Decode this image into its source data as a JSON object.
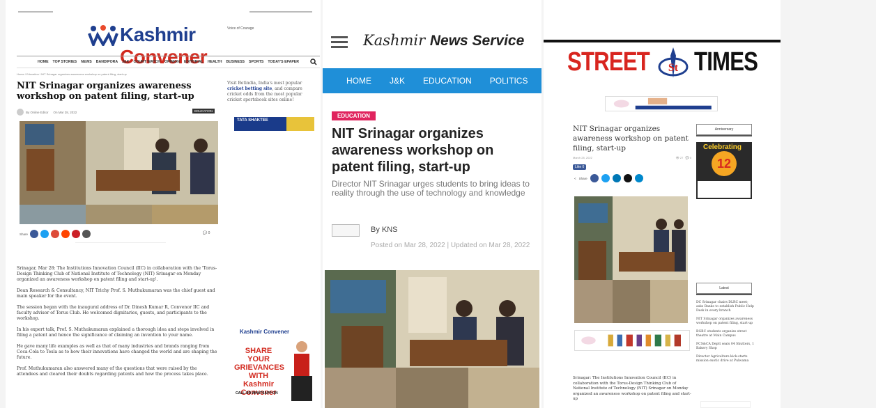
{
  "panel1": {
    "logo_k": "Kashmir",
    "logo_c": "Convener",
    "tagline": "Voice of Courage",
    "nav": [
      "HOME",
      "TOP STORIES",
      "NEWS",
      "BANDIPORA",
      "J&K",
      "COURT WATCH",
      "OPINION",
      "EDITORIAL",
      "HEALTH",
      "BUSINESS",
      "SPORTS",
      "TODAY'S EPAPER"
    ],
    "breadcrumb": "Home  /  Education  /  NIT Srinagar organizes awareness workshop on patent filing, start-up",
    "title": "NIT Srinagar organizes awareness workshop on patent filing, start-up",
    "author": "By  Online Editor",
    "date": "On  Mar 28, 2022",
    "category": "EDUCATION",
    "share_label": "Share",
    "comments": "0",
    "side_text_pre": "Visit Betindia, India's most popular ",
    "side_text_link": "cricket betting site",
    "side_text_post": ", and compare cricket odds from the most popular cricket sportsbook sites online!",
    "tata_label": "TATA SHAKTEE",
    "paragraphs": [
      "Srinagar, Mar 28: The Institutions Innovation Council (IIC) in collaboration with the 'Torus-Design Thinking Club of National Institute of Technology (NIT) Srinagar on Monday organized an awareness workshop on patent filing and start-up'.",
      "Dean Research & Consultancy, NIT Trichy Prof. S. Muthukumaran was the chief guest and main speaker for the event.",
      "The session began with the inaugural address of Dr. Dinesh Kumar R, Convenor IIC and faculty advisor of Torus Club. He welcomed dignitaries, guests, and participants to the workshop.",
      "In his expert talk, Prof. S. Muthukumaran explained a thorough idea and steps involved in filing a patent and hence the significance of claiming an invention to your name.",
      "He gave many life examples as well as that of many industries and brands ranging from Coca-Cola to Tesla as to how their innovations have changed the world and are shaping the future.",
      "Prof. Muthukumaran also answered many of the questions that were raised by the attendees and cleared their doubts regarding patents and how the process takes place."
    ],
    "grievance": {
      "brand": "Kashmir Convener",
      "headline": "SHARE YOUR GRIEVANCES WITH Kashmir Convener",
      "call": "CALL OR WHATSAPP ON"
    }
  },
  "panel2": {
    "brand_a": "Kashmir ",
    "brand_b": "News Service",
    "nav": [
      "HOME",
      "J&K",
      "EDUCATION",
      "POLITICS"
    ],
    "category": "EDUCATION",
    "title": "NIT Srinagar organizes awareness workshop on patent filing, start-up",
    "subtitle": "Director NIT Srinagar urges students to bring ideas to reality through the use of technology and knowledge",
    "author": "By KNS",
    "dates": "Posted on Mar 28, 2022 | Updated on Mar 28, 2022"
  },
  "panel3": {
    "logo_left": "STREET",
    "logo_right": "TIMES",
    "title": "NIT Srinagar organizes awareness workshop on patent filing, start-up",
    "meta_date": "March 28, 2022",
    "meta_views": "27",
    "meta_comments": "0",
    "like": "Like 0",
    "share_label": "Share",
    "anniversary_head": "Anniversary",
    "celebrating": "Celebrating",
    "anniversary_num": "12",
    "latest_head": "Latest",
    "latest": [
      "DC Srinagar chairs DLRC meet; asks Banks to establish Public Help Desk in every branch",
      "NIT Srinagar organizes awareness workshop on patent filing, start-up",
      "BGBC students organize street theatre at Main Campus",
      "FCS&CA Deptt seals 04 Shutters, 1 Bakery Shop",
      "Director Agriculture kick-starts mission exotic drive at Pulwama"
    ],
    "body": "Srinagar: The Institutions Innovation Council (IIC) in collaboration with the Torus-Design Thinking Club of National Institute of Technology (NIT) Srinagar on Monday organized an awareness workshop on patent filing and start-up"
  }
}
